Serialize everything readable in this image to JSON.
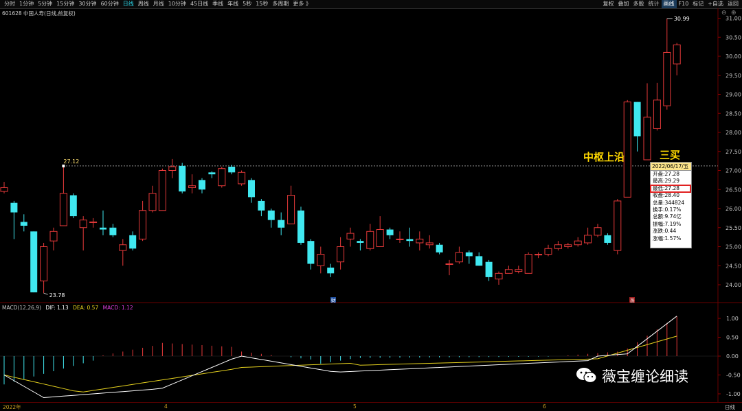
{
  "toolbar": {
    "periods": [
      "分时",
      "1分钟",
      "5分钟",
      "15分钟",
      "30分钟",
      "60分钟",
      "日线",
      "周线",
      "月线",
      "10分钟",
      "45日线",
      "季线",
      "年线",
      "5秒",
      "15秒",
      "多周期",
      "更多 》"
    ],
    "active_period": "日线",
    "right_buttons": [
      "复权",
      "叠加",
      "多股",
      "统计",
      "画线",
      "F10",
      "标记",
      "+自选",
      "返回"
    ],
    "highlighted_button": "画线"
  },
  "stock_title": "601628 中国人寿(日线,前复权)",
  "main_chart": {
    "y_ticks": [
      "31.00",
      "30.50",
      "30.00",
      "29.50",
      "29.00",
      "28.50",
      "28.00",
      "27.50",
      "27.00",
      "26.50",
      "26.00",
      "25.50",
      "25.00",
      "24.50",
      "24.00"
    ],
    "high_label": "30.99",
    "prev_high_label": "27.12",
    "low_label": "23.78",
    "dotted_level": 27.12,
    "marker_cai": "财",
    "marker_zhang": "涨"
  },
  "annotations": {
    "upper_edge": "中枢上沿",
    "third_buy": "三买"
  },
  "info_box": {
    "date": "2022/06/17/五",
    "open": "开盘:27.28",
    "high": "最高:29.29",
    "low": "最低:27.28",
    "close": "收盘:28.40",
    "volume": "总量:344824",
    "turnover": "换手:0.17%",
    "amount": "总额:9.74亿",
    "amplitude": "振幅:7.19%",
    "change": "涨跌:0.44",
    "change_pct": "涨幅:1.57%"
  },
  "macd": {
    "title": "MACD(12,26,9)",
    "dif": "DIF: 1.13",
    "dea": "DEA: 0.57",
    "macd": "MACD: 1.12",
    "y_ticks": [
      "1.00",
      "0.50",
      "0.00",
      "-0.50",
      "-1.00"
    ]
  },
  "x_labels": [
    "2022年",
    "4",
    "5",
    "6"
  ],
  "bottom_right": "日线",
  "watermark": "薇宝缠论细读",
  "colors": {
    "up": "#e83a3a",
    "down": "#40e8f0",
    "dif": "#ffffff",
    "dea": "#e6d21e"
  },
  "chart_data": {
    "type": "candlestick",
    "candles": [
      [
        26.45,
        26.55,
        26.7,
        26.4
      ],
      [
        26.15,
        25.9,
        26.2,
        25.2
      ],
      [
        25.65,
        25.55,
        25.85,
        25.4
      ],
      [
        25.4,
        23.8,
        25.4,
        23.8
      ],
      [
        24.1,
        25.0,
        25.1,
        23.78
      ],
      [
        25.15,
        25.4,
        25.5,
        24.9
      ],
      [
        25.55,
        26.4,
        27.12,
        25.55
      ],
      [
        26.35,
        25.8,
        26.4,
        25.75
      ],
      [
        25.5,
        25.7,
        25.8,
        24.9
      ],
      [
        25.65,
        25.65,
        25.75,
        25.5
      ],
      [
        25.5,
        25.45,
        25.95,
        25.3
      ],
      [
        25.5,
        25.3,
        25.6,
        25.25
      ],
      [
        24.9,
        25.05,
        25.2,
        24.5
      ],
      [
        25.3,
        24.95,
        25.4,
        24.9
      ],
      [
        25.2,
        25.95,
        26.2,
        25.15
      ],
      [
        25.95,
        26.4,
        26.6,
        25.9
      ],
      [
        25.95,
        27.0,
        27.05,
        25.95
      ],
      [
        27.0,
        27.1,
        27.3,
        26.8
      ],
      [
        27.12,
        26.45,
        27.2,
        26.4
      ],
      [
        26.55,
        26.6,
        26.9,
        26.4
      ],
      [
        26.75,
        26.5,
        26.8,
        26.4
      ],
      [
        26.95,
        26.9,
        26.98,
        26.8
      ],
      [
        26.6,
        27.05,
        27.1,
        26.55
      ],
      [
        27.1,
        26.95,
        27.15,
        26.9
      ],
      [
        26.65,
        26.95,
        27.0,
        26.6
      ],
      [
        26.75,
        26.3,
        26.8,
        26.15
      ],
      [
        26.2,
        25.95,
        26.25,
        25.8
      ],
      [
        25.95,
        25.7,
        26.0,
        25.5
      ],
      [
        25.7,
        25.5,
        25.9,
        25.3
      ],
      [
        25.6,
        26.35,
        26.6,
        25.6
      ],
      [
        25.95,
        25.1,
        26.05,
        25.05
      ],
      [
        25.15,
        24.55,
        25.2,
        24.4
      ],
      [
        24.5,
        24.8,
        25.0,
        24.3
      ],
      [
        24.45,
        24.3,
        24.55,
        24.2
      ],
      [
        24.6,
        25.0,
        25.25,
        24.4
      ],
      [
        25.2,
        25.35,
        25.5,
        25.0
      ],
      [
        25.15,
        25.1,
        25.2,
        24.9
      ],
      [
        24.95,
        25.4,
        25.6,
        24.9
      ],
      [
        25.0,
        25.45,
        25.8,
        25.0
      ],
      [
        25.45,
        25.3,
        25.5,
        25.2
      ],
      [
        25.2,
        25.2,
        25.4,
        25.1
      ],
      [
        25.2,
        25.15,
        25.5,
        25.0
      ],
      [
        25.1,
        25.2,
        25.4,
        24.9
      ],
      [
        25.05,
        25.1,
        25.3,
        24.95
      ],
      [
        25.05,
        24.85,
        25.1,
        24.8
      ],
      [
        24.55,
        24.55,
        24.65,
        24.25
      ],
      [
        24.6,
        24.85,
        25.0,
        24.55
      ],
      [
        24.85,
        24.75,
        24.9,
        24.55
      ],
      [
        24.75,
        24.5,
        24.85,
        24.5
      ],
      [
        24.6,
        24.2,
        24.65,
        24.1
      ],
      [
        24.15,
        24.3,
        24.35,
        24.0
      ],
      [
        24.3,
        24.4,
        24.5,
        24.3
      ],
      [
        24.35,
        24.4,
        24.5,
        24.3
      ],
      [
        24.3,
        24.8,
        24.85,
        24.3
      ],
      [
        24.8,
        24.8,
        24.85,
        24.7
      ],
      [
        24.8,
        24.95,
        25.05,
        24.75
      ],
      [
        24.95,
        25.05,
        25.15,
        24.9
      ],
      [
        25.0,
        25.05,
        25.1,
        24.95
      ],
      [
        25.05,
        25.15,
        25.25,
        25.0
      ],
      [
        25.1,
        25.3,
        25.5,
        25.05
      ],
      [
        25.3,
        25.5,
        25.6,
        25.25
      ],
      [
        25.3,
        25.1,
        25.35,
        25.05
      ],
      [
        24.9,
        26.2,
        26.25,
        24.8
      ],
      [
        26.3,
        28.8,
        28.85,
        26.3
      ],
      [
        28.8,
        27.9,
        28.8,
        27.5
      ],
      [
        27.28,
        28.4,
        29.29,
        27.28
      ],
      [
        28.1,
        28.85,
        29.3,
        28.05
      ],
      [
        28.7,
        30.1,
        30.99,
        28.6
      ],
      [
        29.8,
        30.3,
        30.35,
        29.5
      ]
    ],
    "macd_dif_last": 1.13,
    "macd_dea_last": 0.57,
    "macd_hist_last": 1.12
  }
}
